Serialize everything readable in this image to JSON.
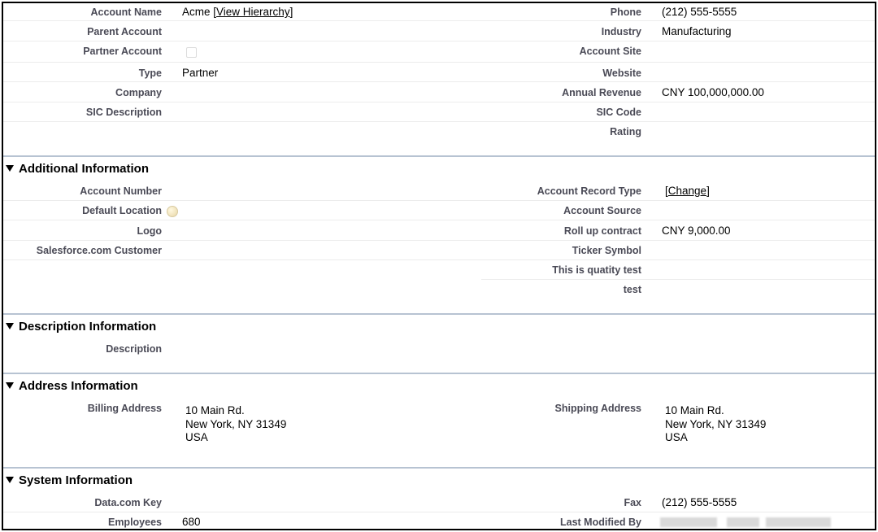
{
  "account_detail": {
    "rows": [
      {
        "left_label": "Account Name",
        "right_label": "Phone",
        "right_value": "(212) 555-5555"
      },
      {
        "left_label": "Parent Account",
        "right_label": "Industry",
        "right_value": "Manufacturing"
      },
      {
        "left_label": "Partner Account",
        "right_label": "Account Site"
      },
      {
        "left_label": "Type",
        "left_value": "Partner",
        "right_label": "Website"
      },
      {
        "left_label": "Company",
        "right_label": "Annual Revenue",
        "right_value": "CNY 100,000,000.00"
      },
      {
        "left_label": "SIC Description",
        "right_label": "SIC Code"
      },
      {
        "right_label": "Rating"
      }
    ],
    "account_name": "Acme",
    "view_hierarchy_link": "View Hierarchy"
  },
  "additional_info": {
    "title": "Additional Information",
    "rows": [
      {
        "left_label": "Account Number",
        "right_label": "Account Record Type"
      },
      {
        "left_label": "Default Location",
        "right_label": "Account Source"
      },
      {
        "left_label": "Logo",
        "right_label": "Roll up contract",
        "right_value": "CNY 9,000.00"
      },
      {
        "left_label": "Salesforce.com Customer",
        "right_label": "Ticker Symbol"
      },
      {
        "right_label": "This is quatity test"
      },
      {
        "right_label": "test"
      }
    ],
    "change_link": "Change"
  },
  "description_info": {
    "title": "Description Information",
    "description_label": "Description"
  },
  "address_info": {
    "title": "Address Information",
    "billing_label": "Billing Address",
    "billing_address": "10 Main Rd.\nNew York, NY 31349\nUSA",
    "shipping_label": "Shipping Address",
    "shipping_address": "10 Main Rd.\nNew York, NY 31349\nUSA"
  },
  "system_info": {
    "title": "System Information",
    "datacom_label": "Data.com Key",
    "fax_label": "Fax",
    "fax_value": "(212) 555-5555",
    "employees_label": "Employees",
    "employees_value": "680",
    "last_modified_label": "Last Modified By"
  }
}
